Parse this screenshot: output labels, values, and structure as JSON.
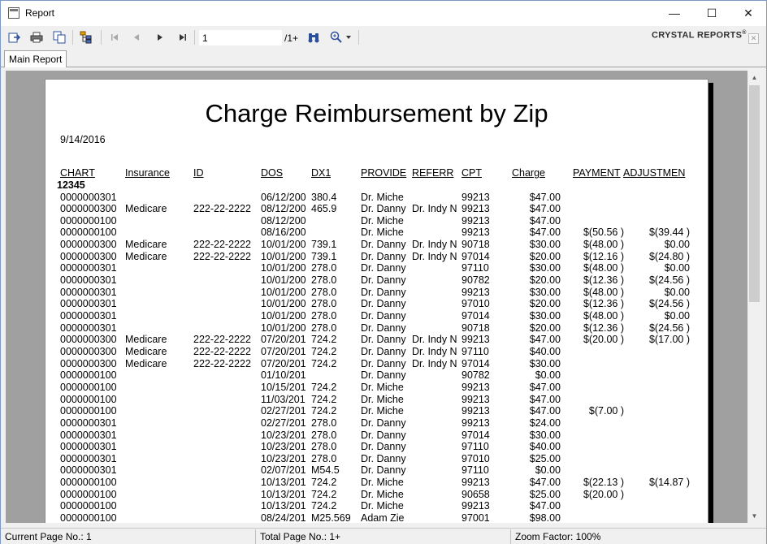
{
  "window": {
    "title": "Report",
    "min_glyph": "—",
    "max_glyph": "☐",
    "close_glyph": "✕"
  },
  "toolbar": {
    "page_value": "1",
    "page_total": "/1+",
    "brand": "CRYSTAL REPORTS",
    "brand_mark": "®",
    "icons": [
      "export-icon",
      "print-icon",
      "copy-icon",
      "group-tree-icon",
      "first-page-icon",
      "prev-page-icon",
      "next-page-icon",
      "last-page-icon",
      "find-icon",
      "zoom-icon"
    ]
  },
  "tabs": {
    "main": "Main Report"
  },
  "report": {
    "title": "Charge Reimbursement by Zip",
    "date": "9/14/2016",
    "headers": {
      "chart": "CHART",
      "insurance": "Insurance",
      "id": "ID",
      "dos": "DOS",
      "dx1": "DX1",
      "provider": "PROVIDE",
      "referr": "REFERR",
      "cpt": "CPT",
      "charge": "Charge",
      "payment": "PAYMENT",
      "adjustment": "ADJUSTMEN"
    },
    "group": "12345",
    "rows": [
      [
        "0000000301",
        "",
        "",
        "06/12/200",
        "380.4",
        "Dr. Miche",
        "",
        "99213",
        "$47.00",
        "",
        ""
      ],
      [
        "0000000300",
        "Medicare",
        "222-22-2222",
        "08/12/200",
        "465.9",
        "Dr. Danny",
        "Dr. Indy N",
        "99213",
        "$47.00",
        "",
        ""
      ],
      [
        "0000000100",
        "",
        "",
        "08/12/200",
        "",
        "Dr. Miche",
        "",
        "99213",
        "$47.00",
        "",
        ""
      ],
      [
        "0000000100",
        "",
        "",
        "08/16/200",
        "",
        "Dr. Miche",
        "",
        "99213",
        "$47.00",
        "$(50.56 )",
        "$(39.44 )"
      ],
      [
        "0000000300",
        "Medicare",
        "222-22-2222",
        "10/01/200",
        "739.1",
        "Dr. Danny",
        "Dr. Indy N",
        "90718",
        "$30.00",
        "$(48.00 )",
        "$0.00"
      ],
      [
        "0000000300",
        "Medicare",
        "222-22-2222",
        "10/01/200",
        "739.1",
        "Dr. Danny",
        "Dr. Indy N",
        "97014",
        "$20.00",
        "$(12.16 )",
        "$(24.80 )"
      ],
      [
        "0000000301",
        "",
        "",
        "10/01/200",
        "278.0",
        "Dr. Danny",
        "",
        "97110",
        "$30.00",
        "$(48.00 )",
        "$0.00"
      ],
      [
        "0000000301",
        "",
        "",
        "10/01/200",
        "278.0",
        "Dr. Danny",
        "",
        "90782",
        "$20.00",
        "$(12.36 )",
        "$(24.56 )"
      ],
      [
        "0000000301",
        "",
        "",
        "10/01/200",
        "278.0",
        "Dr. Danny",
        "",
        "99213",
        "$30.00",
        "$(48.00 )",
        "$0.00"
      ],
      [
        "0000000301",
        "",
        "",
        "10/01/200",
        "278.0",
        "Dr. Danny",
        "",
        "97010",
        "$20.00",
        "$(12.36 )",
        "$(24.56 )"
      ],
      [
        "0000000301",
        "",
        "",
        "10/01/200",
        "278.0",
        "Dr. Danny",
        "",
        "97014",
        "$30.00",
        "$(48.00 )",
        "$0.00"
      ],
      [
        "0000000301",
        "",
        "",
        "10/01/200",
        "278.0",
        "Dr. Danny",
        "",
        "90718",
        "$20.00",
        "$(12.36 )",
        "$(24.56 )"
      ],
      [
        "0000000300",
        "Medicare",
        "222-22-2222",
        "07/20/201",
        "724.2",
        "Dr. Danny",
        "Dr. Indy N",
        "99213",
        "$47.00",
        "$(20.00 )",
        "$(17.00 )"
      ],
      [
        "0000000300",
        "Medicare",
        "222-22-2222",
        "07/20/201",
        "724.2",
        "Dr. Danny",
        "Dr. Indy N",
        "97110",
        "$40.00",
        "",
        ""
      ],
      [
        "0000000300",
        "Medicare",
        "222-22-2222",
        "07/20/201",
        "724.2",
        "Dr. Danny",
        "Dr. Indy N",
        "97014",
        "$30.00",
        "",
        ""
      ],
      [
        "0000000100",
        "",
        "",
        "01/10/201",
        "",
        "Dr. Danny",
        "",
        "90782",
        "$0.00",
        "",
        ""
      ],
      [
        "0000000100",
        "",
        "",
        "10/15/201",
        "724.2",
        "Dr. Miche",
        "",
        "99213",
        "$47.00",
        "",
        ""
      ],
      [
        "0000000100",
        "",
        "",
        "11/03/201",
        "724.2",
        "Dr. Miche",
        "",
        "99213",
        "$47.00",
        "",
        ""
      ],
      [
        "0000000100",
        "",
        "",
        "02/27/201",
        "724.2",
        "Dr. Miche",
        "",
        "99213",
        "$47.00",
        "$(7.00 )",
        ""
      ],
      [
        "0000000301",
        "",
        "",
        "02/27/201",
        "278.0",
        "Dr. Danny",
        "",
        "99213",
        "$24.00",
        "",
        ""
      ],
      [
        "0000000301",
        "",
        "",
        "10/23/201",
        "278.0",
        "Dr. Danny",
        "",
        "97014",
        "$30.00",
        "",
        ""
      ],
      [
        "0000000301",
        "",
        "",
        "10/23/201",
        "278.0",
        "Dr. Danny",
        "",
        "97110",
        "$40.00",
        "",
        ""
      ],
      [
        "0000000301",
        "",
        "",
        "10/23/201",
        "278.0",
        "Dr. Danny",
        "",
        "97010",
        "$25.00",
        "",
        ""
      ],
      [
        "0000000301",
        "",
        "",
        "02/07/201",
        "M54.5",
        "Dr. Danny",
        "",
        "97110",
        "$0.00",
        "",
        ""
      ],
      [
        "0000000100",
        "",
        "",
        "10/13/201",
        "724.2",
        "Dr. Miche",
        "",
        "99213",
        "$47.00",
        "$(22.13 )",
        "$(14.87 )"
      ],
      [
        "0000000100",
        "",
        "",
        "10/13/201",
        "724.2",
        "Dr. Miche",
        "",
        "90658",
        "$25.00",
        "$(20.00 )",
        ""
      ],
      [
        "0000000100",
        "",
        "",
        "10/13/201",
        "724.2",
        "Dr. Miche",
        "",
        "99213",
        "$47.00",
        "",
        ""
      ],
      [
        "0000000100",
        "",
        "",
        "08/24/201",
        "M25.569",
        "Adam Zie",
        "",
        "97001",
        "$98.00",
        "",
        ""
      ]
    ]
  },
  "status": {
    "current_page": "Current Page No.: 1",
    "total_page": "Total Page No.: 1+",
    "zoom": "Zoom Factor: 100%"
  }
}
